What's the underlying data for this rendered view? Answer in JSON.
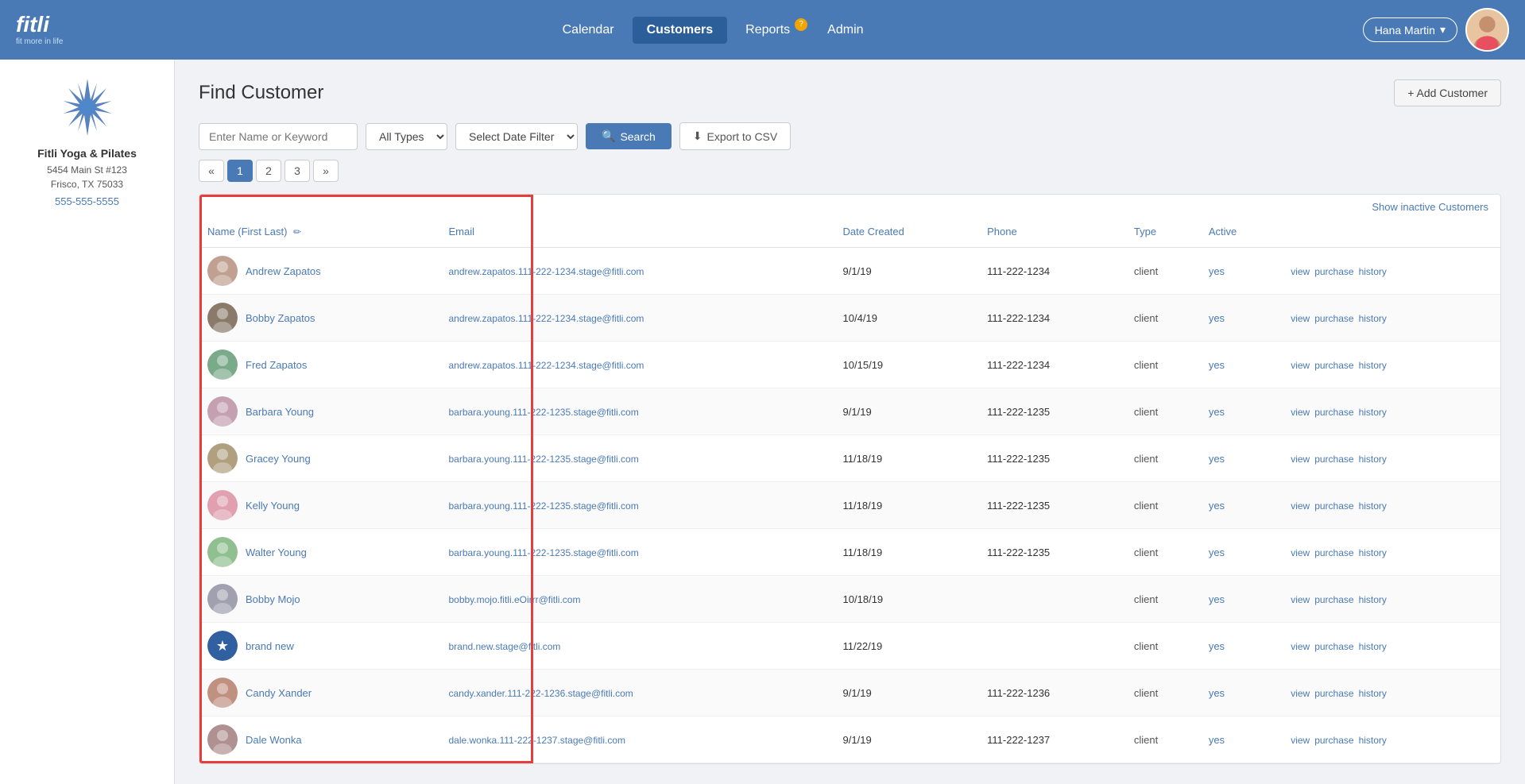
{
  "header": {
    "logo_text": "fitli",
    "logo_tagline": "fit more in life",
    "nav_items": [
      {
        "id": "calendar",
        "label": "Calendar",
        "active": false
      },
      {
        "id": "customers",
        "label": "Customers",
        "active": true
      },
      {
        "id": "reports",
        "label": "Reports",
        "active": false,
        "badge": "?"
      },
      {
        "id": "admin",
        "label": "Admin",
        "active": false
      }
    ],
    "user_name": "Hana Martin",
    "user_dropdown_icon": "▾"
  },
  "sidebar": {
    "company_name": "Fitli Yoga & Pilates",
    "address_line1": "5454 Main St #123",
    "address_line2": "Frisco, TX 75033",
    "phone": "555-555-5555"
  },
  "page": {
    "title": "Find Customer",
    "add_button_label": "+ Add Customer"
  },
  "search": {
    "input_placeholder": "Enter Name or Keyword",
    "type_filter_default": "All Types",
    "date_filter_default": "Select Date Filter",
    "search_button_label": "Search",
    "export_button_label": "Export to CSV"
  },
  "pagination": {
    "prev_label": "«",
    "next_label": "»",
    "pages": [
      "1",
      "2",
      "3"
    ],
    "active_page": "1"
  },
  "table": {
    "show_inactive_label": "Show inactive Customers",
    "columns": [
      {
        "id": "name",
        "label": "Name (First Last)",
        "editable": true
      },
      {
        "id": "email",
        "label": "Email"
      },
      {
        "id": "date_created",
        "label": "Date Created"
      },
      {
        "id": "phone",
        "label": "Phone"
      },
      {
        "id": "type",
        "label": "Type"
      },
      {
        "id": "active",
        "label": "Active"
      },
      {
        "id": "actions",
        "label": ""
      }
    ],
    "rows": [
      {
        "id": 1,
        "avatar_color": "#a0b8d0",
        "avatar_emoji": "👤",
        "name": "Andrew Zapatos",
        "email": "andrew.zapatos.111-222-1234.stage@fitli.com",
        "date_created": "9/1/19",
        "phone": "111-222-1234",
        "type": "client",
        "active": "yes",
        "actions": [
          "view",
          "purchase",
          "history"
        ]
      },
      {
        "id": 2,
        "avatar_color": "#8a6a5a",
        "avatar_emoji": "👤",
        "name": "Bobby Zapatos",
        "email": "andrew.zapatos.111-222-1234.stage@fitli.com",
        "date_created": "10/4/19",
        "phone": "111-222-1234",
        "type": "client",
        "active": "yes",
        "actions": [
          "view",
          "purchase",
          "history"
        ]
      },
      {
        "id": 3,
        "avatar_color": "#7aaa8a",
        "avatar_emoji": "👤",
        "name": "Fred Zapatos",
        "email": "andrew.zapatos.111-222-1234.stage@fitli.com",
        "date_created": "10/15/19",
        "phone": "111-222-1234",
        "type": "client",
        "active": "yes",
        "actions": [
          "view",
          "purchase",
          "history"
        ]
      },
      {
        "id": 4,
        "avatar_color": "#c4a0b0",
        "avatar_emoji": "👤",
        "name": "Barbara Young",
        "email": "barbara.young.111-222-1235.stage@fitli.com",
        "date_created": "9/1/19",
        "phone": "111-222-1235",
        "type": "client",
        "active": "yes",
        "actions": [
          "view",
          "purchase",
          "history"
        ]
      },
      {
        "id": 5,
        "avatar_color": "#b0a080",
        "avatar_emoji": "👤",
        "name": "Gracey Young",
        "email": "barbara.young.111-222-1235.stage@fitli.com",
        "date_created": "11/18/19",
        "phone": "111-222-1235",
        "type": "client",
        "active": "yes",
        "actions": [
          "view",
          "purchase",
          "history"
        ]
      },
      {
        "id": 6,
        "avatar_color": "#e0a0b0",
        "avatar_emoji": "👤",
        "name": "Kelly Young",
        "email": "barbara.young.111-222-1235.stage@fitli.com",
        "date_created": "11/18/19",
        "phone": "111-222-1235",
        "type": "client",
        "active": "yes",
        "actions": [
          "view",
          "purchase",
          "history"
        ]
      },
      {
        "id": 7,
        "avatar_color": "#90c090",
        "avatar_emoji": "👤",
        "name": "Walter Young",
        "email": "barbara.young.111-222-1235.stage@fitli.com",
        "date_created": "11/18/19",
        "phone": "111-222-1235",
        "type": "client",
        "active": "yes",
        "actions": [
          "view",
          "purchase",
          "history"
        ]
      },
      {
        "id": 8,
        "avatar_color": "#a0a0b0",
        "avatar_emoji": "👤",
        "name": "Bobby Mojo",
        "email": "bobby.mojo.fitli.eOirrr@fitli.com",
        "date_created": "10/18/19",
        "phone": "",
        "type": "client",
        "active": "yes",
        "actions": [
          "view",
          "purchase",
          "history"
        ]
      },
      {
        "id": 9,
        "avatar_color": "#3060a0",
        "avatar_emoji": "★",
        "name": "brand new",
        "email": "brand.new.stage@fitli.com",
        "date_created": "11/22/19",
        "phone": "",
        "type": "client",
        "active": "yes",
        "actions": [
          "view",
          "purchase",
          "history"
        ]
      },
      {
        "id": 10,
        "avatar_color": "#c09080",
        "avatar_emoji": "👤",
        "name": "Candy Xander",
        "email": "candy.xander.111-222-1236.stage@fitli.com",
        "date_created": "9/1/19",
        "phone": "111-222-1236",
        "type": "client",
        "active": "yes",
        "actions": [
          "view",
          "purchase",
          "history"
        ]
      },
      {
        "id": 11,
        "avatar_color": "#b09090",
        "avatar_emoji": "👤",
        "name": "Dale Wonka",
        "email": "dale.wonka.111-222-1237.stage@fitli.com",
        "date_created": "9/1/19",
        "phone": "111-222-1237",
        "type": "client",
        "active": "yes",
        "actions": [
          "view",
          "purchase",
          "history"
        ]
      }
    ]
  },
  "icons": {
    "search": "🔍",
    "download": "⬇",
    "edit": "✏",
    "chevron_down": "▾"
  }
}
